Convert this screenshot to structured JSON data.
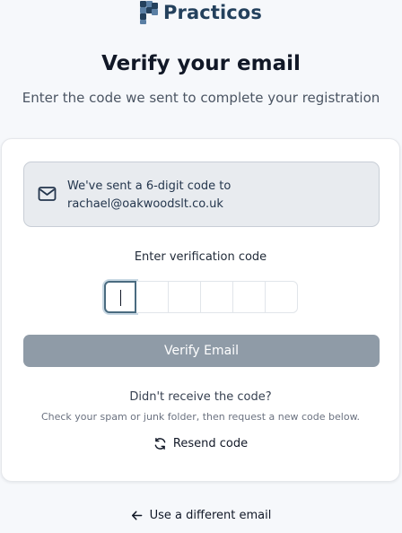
{
  "brand": {
    "name": "Practicos",
    "color": "#24415d"
  },
  "header": {
    "title": "Verify your email",
    "subtitle": "Enter the code we sent to complete your registration"
  },
  "notice": {
    "line1": "We've sent a 6-digit code to",
    "email": "rachael@oakwoodslt.co.uk",
    "icon": "mail-icon"
  },
  "verification": {
    "label": "Enter verification code",
    "digits": [
      "",
      "",
      "",
      "",
      "",
      ""
    ]
  },
  "actions": {
    "verify_label": "Verify Email",
    "verify_disabled_color": "#8f9ba7",
    "didnt_receive": "Didn't receive the code?",
    "hint": "Check your spam or junk folder, then request a new code below.",
    "resend_label": "Resend code",
    "resend_icon": "refresh-icon",
    "different_email_label": "Use a different email",
    "back_icon": "arrow-left-icon"
  }
}
